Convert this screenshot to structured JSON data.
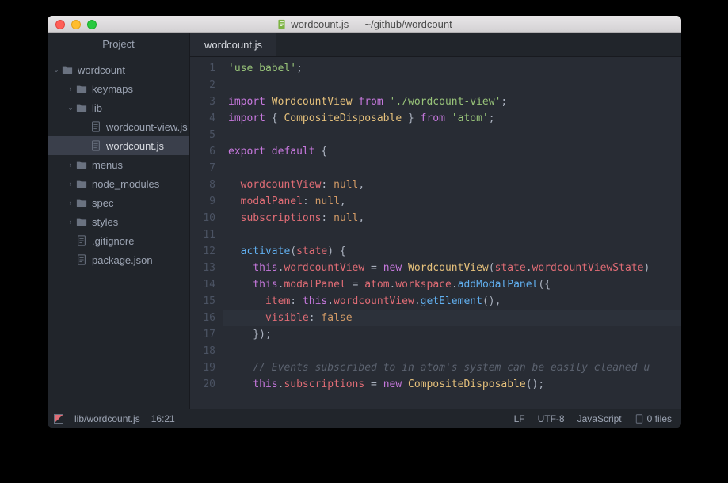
{
  "window": {
    "title": "wordcount.js — ~/github/wordcount"
  },
  "sidebar": {
    "header": "Project",
    "items": [
      {
        "label": "wordcount",
        "type": "folder",
        "expanded": true,
        "depth": 0
      },
      {
        "label": "keymaps",
        "type": "folder",
        "expanded": false,
        "depth": 1
      },
      {
        "label": "lib",
        "type": "folder",
        "expanded": true,
        "depth": 1
      },
      {
        "label": "wordcount-view.js",
        "type": "file",
        "depth": 2
      },
      {
        "label": "wordcount.js",
        "type": "file",
        "depth": 2,
        "selected": true
      },
      {
        "label": "menus",
        "type": "folder",
        "expanded": false,
        "depth": 1
      },
      {
        "label": "node_modules",
        "type": "folder",
        "expanded": false,
        "depth": 1
      },
      {
        "label": "spec",
        "type": "folder",
        "expanded": false,
        "depth": 1
      },
      {
        "label": "styles",
        "type": "folder",
        "expanded": false,
        "depth": 1
      },
      {
        "label": ".gitignore",
        "type": "file",
        "depth": 1
      },
      {
        "label": "package.json",
        "type": "file",
        "depth": 1
      }
    ]
  },
  "tabs": [
    {
      "label": "wordcount.js",
      "active": true
    }
  ],
  "code": {
    "lines": [
      [
        [
          "tok-str",
          "'use babel'"
        ],
        [
          "tok-def",
          ";"
        ]
      ],
      [],
      [
        [
          "tok-kw",
          "import"
        ],
        [
          "tok-def",
          " "
        ],
        [
          "tok-cls",
          "WordcountView"
        ],
        [
          "tok-def",
          " "
        ],
        [
          "tok-kw",
          "from"
        ],
        [
          "tok-def",
          " "
        ],
        [
          "tok-str",
          "'./wordcount-view'"
        ],
        [
          "tok-def",
          ";"
        ]
      ],
      [
        [
          "tok-kw",
          "import"
        ],
        [
          "tok-def",
          " { "
        ],
        [
          "tok-cls",
          "CompositeDisposable"
        ],
        [
          "tok-def",
          " } "
        ],
        [
          "tok-kw",
          "from"
        ],
        [
          "tok-def",
          " "
        ],
        [
          "tok-str",
          "'atom'"
        ],
        [
          "tok-def",
          ";"
        ]
      ],
      [],
      [
        [
          "tok-kw",
          "export"
        ],
        [
          "tok-def",
          " "
        ],
        [
          "tok-kw",
          "default"
        ],
        [
          "tok-def",
          " {"
        ]
      ],
      [],
      [
        [
          "tok-def",
          "  "
        ],
        [
          "tok-var",
          "wordcountView"
        ],
        [
          "tok-def",
          ": "
        ],
        [
          "tok-const",
          "null"
        ],
        [
          "tok-def",
          ","
        ]
      ],
      [
        [
          "tok-def",
          "  "
        ],
        [
          "tok-var",
          "modalPanel"
        ],
        [
          "tok-def",
          ": "
        ],
        [
          "tok-const",
          "null"
        ],
        [
          "tok-def",
          ","
        ]
      ],
      [
        [
          "tok-def",
          "  "
        ],
        [
          "tok-var",
          "subscriptions"
        ],
        [
          "tok-def",
          ": "
        ],
        [
          "tok-const",
          "null"
        ],
        [
          "tok-def",
          ","
        ]
      ],
      [],
      [
        [
          "tok-def",
          "  "
        ],
        [
          "tok-fn",
          "activate"
        ],
        [
          "tok-def",
          "("
        ],
        [
          "tok-var",
          "state"
        ],
        [
          "tok-def",
          ") {"
        ]
      ],
      [
        [
          "tok-def",
          "    "
        ],
        [
          "tok-kw",
          "this"
        ],
        [
          "tok-def",
          "."
        ],
        [
          "tok-var",
          "wordcountView"
        ],
        [
          "tok-def",
          " = "
        ],
        [
          "tok-kw",
          "new"
        ],
        [
          "tok-def",
          " "
        ],
        [
          "tok-cls",
          "WordcountView"
        ],
        [
          "tok-def",
          "("
        ],
        [
          "tok-var",
          "state"
        ],
        [
          "tok-def",
          "."
        ],
        [
          "tok-var",
          "wordcountViewState"
        ],
        [
          "tok-def",
          ")"
        ]
      ],
      [
        [
          "tok-def",
          "    "
        ],
        [
          "tok-kw",
          "this"
        ],
        [
          "tok-def",
          "."
        ],
        [
          "tok-var",
          "modalPanel"
        ],
        [
          "tok-def",
          " = "
        ],
        [
          "tok-var",
          "atom"
        ],
        [
          "tok-def",
          "."
        ],
        [
          "tok-var",
          "workspace"
        ],
        [
          "tok-def",
          "."
        ],
        [
          "tok-fn",
          "addModalPanel"
        ],
        [
          "tok-def",
          "({"
        ]
      ],
      [
        [
          "tok-def",
          "      "
        ],
        [
          "tok-var",
          "item"
        ],
        [
          "tok-def",
          ": "
        ],
        [
          "tok-kw",
          "this"
        ],
        [
          "tok-def",
          "."
        ],
        [
          "tok-var",
          "wordcountView"
        ],
        [
          "tok-def",
          "."
        ],
        [
          "tok-fn",
          "getElement"
        ],
        [
          "tok-def",
          "(),"
        ]
      ],
      [
        [
          "tok-def",
          "      "
        ],
        [
          "tok-var",
          "visible"
        ],
        [
          "tok-def",
          ": "
        ],
        [
          "tok-const",
          "false"
        ]
      ],
      [
        [
          "tok-def",
          "    });"
        ]
      ],
      [],
      [
        [
          "tok-def",
          "    "
        ],
        [
          "tok-cm",
          "// Events subscribed to in atom's system can be easily cleaned u"
        ]
      ],
      [
        [
          "tok-def",
          "    "
        ],
        [
          "tok-kw",
          "this"
        ],
        [
          "tok-def",
          "."
        ],
        [
          "tok-var",
          "subscriptions"
        ],
        [
          "tok-def",
          " = "
        ],
        [
          "tok-kw",
          "new"
        ],
        [
          "tok-def",
          " "
        ],
        [
          "tok-cls",
          "CompositeDisposable"
        ],
        [
          "tok-def",
          "();"
        ]
      ]
    ],
    "highlight_line": 16
  },
  "status": {
    "path": "lib/wordcount.js",
    "cursor": "16:21",
    "eol": "LF",
    "encoding": "UTF-8",
    "grammar": "JavaScript",
    "files": "0 files"
  }
}
